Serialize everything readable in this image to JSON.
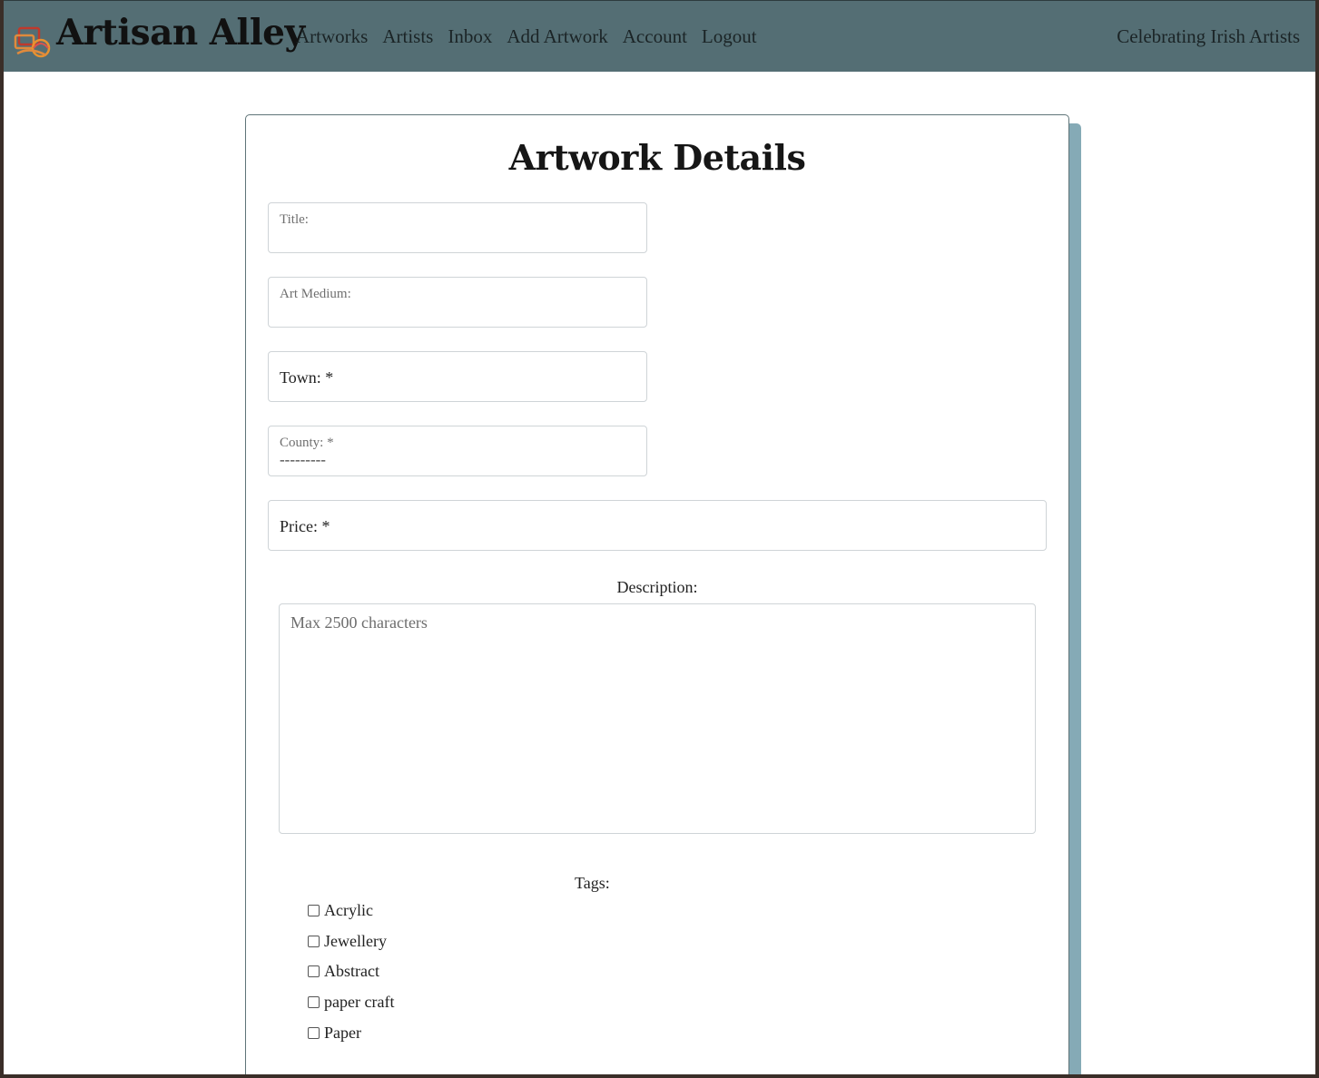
{
  "brand": {
    "name": "Artisan Alley",
    "logo_icon": "palette-logo-icon"
  },
  "nav": {
    "links": [
      "Artworks",
      "Artists",
      "Inbox",
      "Add Artwork",
      "Account",
      "Logout"
    ],
    "tagline": "Celebrating Irish Artists"
  },
  "colors": {
    "navbar": "#546e74",
    "card_shadow": "#85aab6"
  },
  "form": {
    "title": "Artwork Details",
    "fields": {
      "title_label": "Title:",
      "medium_label": "Art Medium:",
      "town_label": "Town: *",
      "county_label": "County: *",
      "county_value": "---------",
      "price_label": "Price: *"
    },
    "description": {
      "label": "Description:",
      "placeholder": "Max 2500 characters"
    },
    "tags": {
      "label": "Tags:",
      "items": [
        "Acrylic",
        "Jewellery",
        "Abstract",
        "paper craft",
        "Paper"
      ]
    }
  }
}
